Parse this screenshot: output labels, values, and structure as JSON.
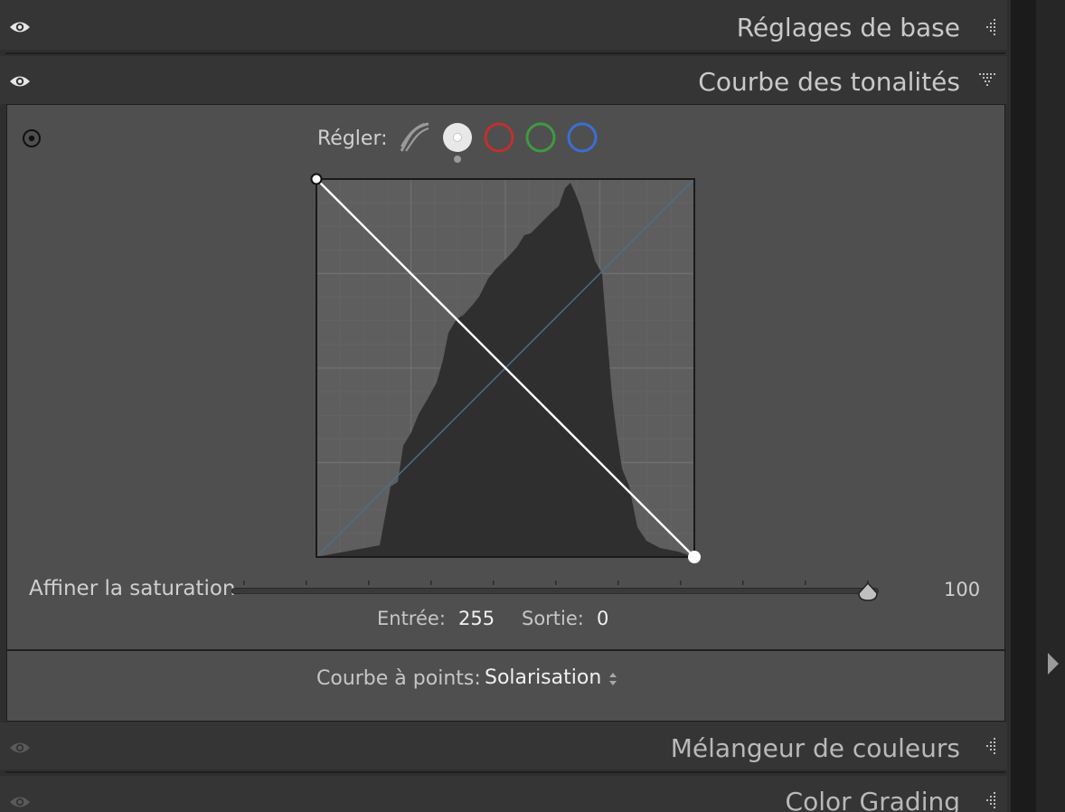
{
  "sections": {
    "basic": {
      "title": "Réglages de base",
      "expanded": false
    },
    "tone_curve": {
      "title": "Courbe des tonalités",
      "expanded": true
    },
    "color_mixer": {
      "title": "Mélangeur de couleurs",
      "expanded": false
    },
    "color_grading": {
      "title": "Color Grading",
      "expanded": false
    }
  },
  "tone_curve": {
    "adjust_label": "Régler:",
    "channels": [
      {
        "id": "parametric",
        "icon": "parametric-curve-icon"
      },
      {
        "id": "point",
        "icon": "white-point-curve-icon",
        "selected": true
      },
      {
        "id": "red",
        "icon": "red-channel-icon",
        "color": "#c0302e"
      },
      {
        "id": "green",
        "icon": "green-channel-icon",
        "color": "#3f9a3f"
      },
      {
        "id": "blue",
        "icon": "blue-channel-icon",
        "color": "#3b6fd0"
      }
    ],
    "curve_points": [
      [
        0,
        255
      ],
      [
        255,
        0
      ]
    ],
    "refine_saturation": {
      "label": "Affiner la saturation",
      "value": "100",
      "fraction": 1.0
    },
    "input_label": "Entrée:",
    "input_value": "255",
    "output_label": "Sortie:",
    "output_value": "0",
    "point_curve_label": "Courbe à points:",
    "point_curve_value": "Solarisation"
  },
  "colors": {
    "panel_bg": "#4f4f4f",
    "header_bg": "#353535",
    "histogram": "#2e2e2e",
    "curve": "#ffffff",
    "baseline": "#4f6b8c"
  }
}
